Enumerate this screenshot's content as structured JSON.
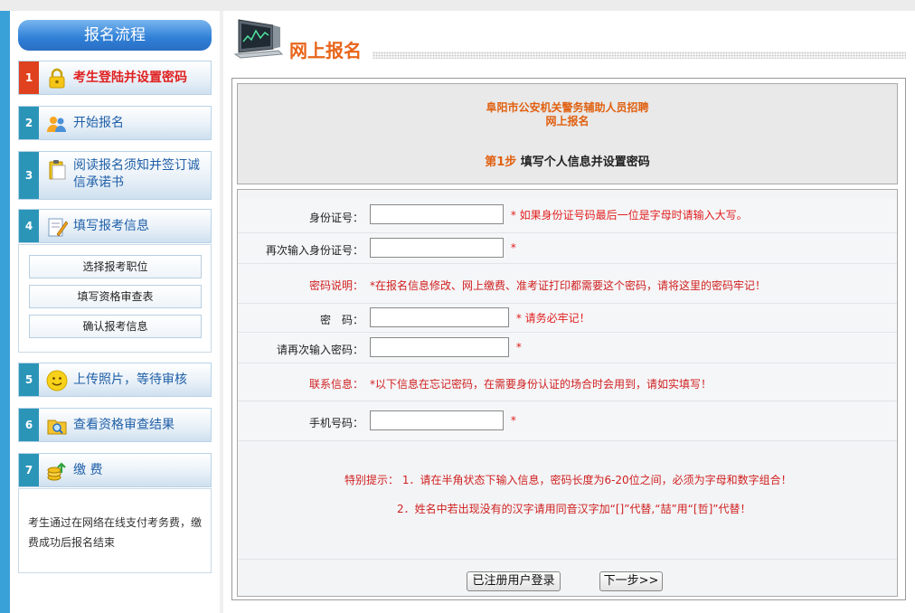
{
  "sidebar": {
    "title": "报名流程",
    "steps": [
      {
        "num": "1",
        "label": "考生登陆并设置密码",
        "icon": "lock-icon"
      },
      {
        "num": "2",
        "label": "开始报名",
        "icon": "users-icon"
      },
      {
        "num": "3",
        "label": "阅读报名须知并签订诚",
        "label2": "信承诺书",
        "icon": "clipboard-icon"
      },
      {
        "num": "4",
        "label": "填写报考信息",
        "icon": "note-pencil-icon"
      },
      {
        "num": "5",
        "label": "上传照片，等待审核",
        "icon": "smiley-icon"
      },
      {
        "num": "6",
        "label": "查看资格审查结果",
        "icon": "folder-search-icon"
      },
      {
        "num": "7",
        "label": "缴 费",
        "icon": "coins-icon"
      }
    ],
    "sub_items": [
      "选择报考职位",
      "填写资格审查表",
      "确认报考信息"
    ],
    "pay_note": "考生通过在网络在线支付考务费，缴费成功后报名结束"
  },
  "header": {
    "title": "网上报名",
    "icon": "monitor-chart-icon"
  },
  "form_header": {
    "org": "阜阳市公安机关警务辅助人员招聘",
    "sub": "网上报名",
    "step_num": "第1步",
    "step_text": "填写个人信息并设置密码"
  },
  "form": {
    "id_label": "身份证号：",
    "id_value": "",
    "id_hint": "* 如果身份证号码最后一位是字母时请输入大写。",
    "id2_label": "再次输入身份证号：",
    "id2_value": "",
    "id2_hint": "*",
    "pwd_note_label": "密码说明：",
    "pwd_note": "*在报名信息修改、网上缴费、准考证打印都需要这个密码，请将这里的密码牢记！",
    "pwd_label": "密　码：",
    "pwd_value": "",
    "pwd_hint": "* 请务必牢记！",
    "pwd2_label": "请再次输入密码：",
    "pwd2_value": "",
    "pwd2_hint": "*",
    "contact_label": "联系信息：",
    "contact_note": "*以下信息在忘记密码，在需要身份认证的场合时会用到，请如实填写！",
    "phone_label": "手机号码：",
    "phone_value": "",
    "phone_hint": "*"
  },
  "tips": {
    "line1": "特别提示： 1．请在半角状态下输入信息，密码长度为6-20位之间，必须为字母和数字组合！",
    "line2": "2．姓名中若出现没有的汉字请用同音汉字加“[]”代替,“喆”用“[哲]”代替！"
  },
  "buttons": {
    "login": "已注册用户登录",
    "next": "下一步>>"
  },
  "colors": {
    "accent_orange": "#e8651a",
    "step_blue": "#2b95b8",
    "active_red": "#e0411e",
    "warn_red": "#d02020"
  }
}
